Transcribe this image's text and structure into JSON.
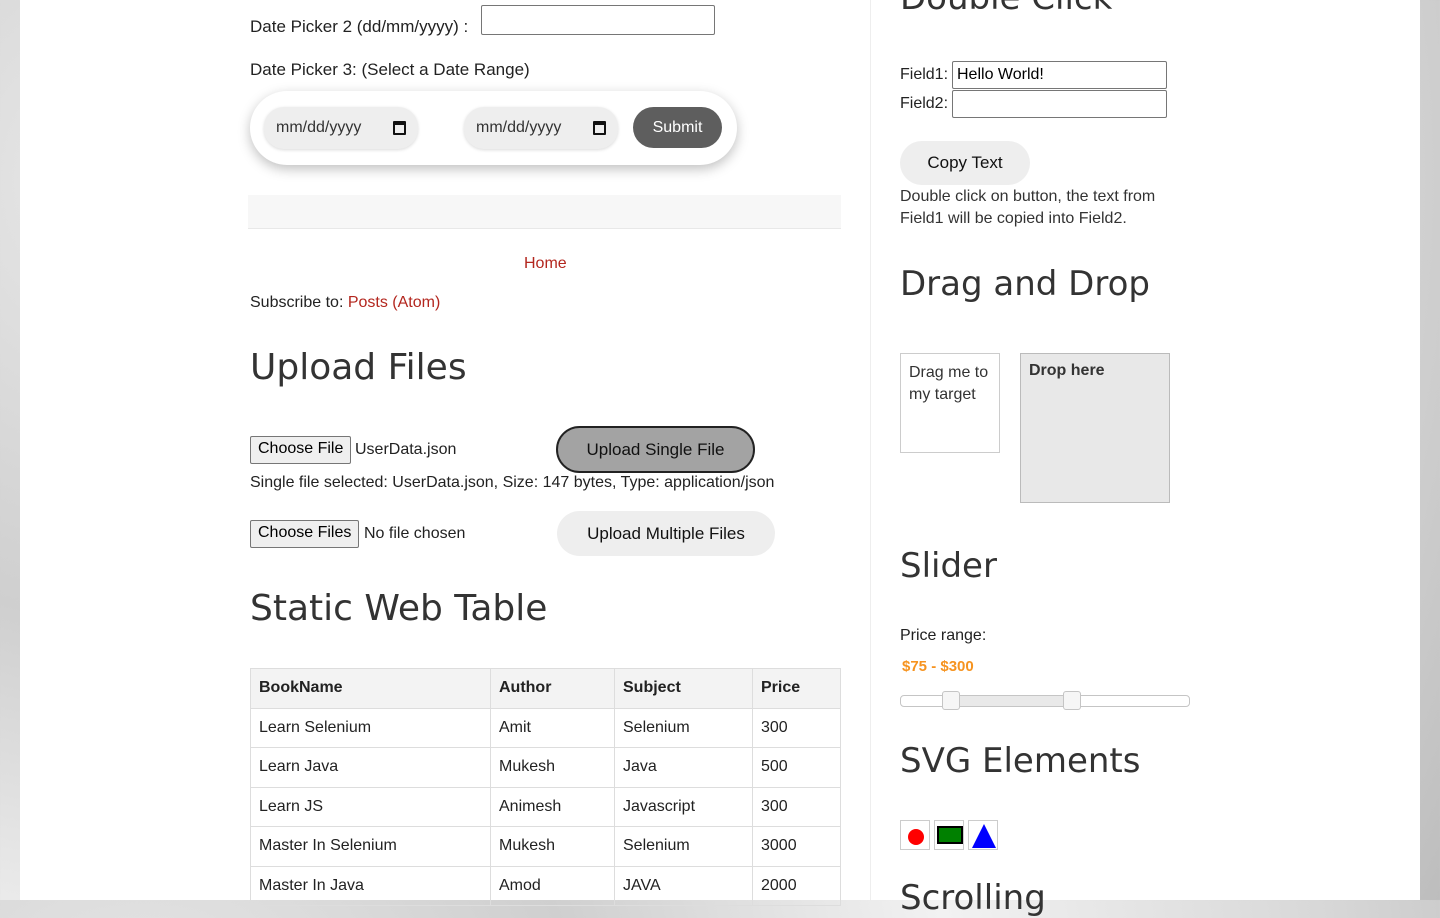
{
  "date_picker_2": {
    "label": "Date Picker 2 (dd/mm/yyyy) :",
    "value": ""
  },
  "date_picker_3": {
    "label": "Date Picker 3: (Select a Date Range)",
    "start_placeholder": "mm/dd/yyyy",
    "end_placeholder": "mm/dd/yyyy",
    "submit_label": "Submit"
  },
  "footer": {
    "home_link": "Home",
    "subscribe_prefix": "Subscribe to: ",
    "subscribe_link": "Posts (Atom)"
  },
  "upload": {
    "title": "Upload Files",
    "single_choose_label": "Choose File",
    "single_file_name": "UserData.json",
    "single_button_label": "Upload Single File",
    "single_status": "Single file selected: UserData.json, Size: 147 bytes, Type: application/json",
    "multi_choose_label": "Choose Files",
    "multi_file_name": "No file chosen",
    "multi_button_label": "Upload Multiple Files"
  },
  "static_table": {
    "title": "Static Web Table",
    "headers": [
      "BookName",
      "Author",
      "Subject",
      "Price"
    ],
    "rows": [
      [
        "Learn Selenium",
        "Amit",
        "Selenium",
        "300"
      ],
      [
        "Learn Java",
        "Mukesh",
        "Java",
        "500"
      ],
      [
        "Learn JS",
        "Animesh",
        "Javascript",
        "300"
      ],
      [
        "Master In Selenium",
        "Mukesh",
        "Selenium",
        "3000"
      ],
      [
        "Master In Java",
        "Amod",
        "JAVA",
        "2000"
      ]
    ]
  },
  "double_click": {
    "title": "Double Click",
    "field1_label": "Field1:",
    "field1_value": "Hello World!",
    "field2_label": "Field2:",
    "field2_value": "",
    "button_label": "Copy Text",
    "description": "Double click on button, the text from Field1 will be copied into Field2."
  },
  "drag_drop": {
    "title": "Drag and Drop",
    "draggable_text": "Drag me to my target",
    "droppable_text": "Drop here"
  },
  "slider": {
    "title": "Slider",
    "label": "Price range:",
    "range_text": "$75 - $300",
    "min": 0,
    "max": 500,
    "low": 75,
    "high": 300,
    "range_color": "#f6931f"
  },
  "svg_elements": {
    "title": "SVG Elements",
    "shapes": [
      {
        "name": "circle",
        "color": "#ff0000"
      },
      {
        "name": "rectangle",
        "color": "#008000"
      },
      {
        "name": "triangle",
        "color": "#0000ff"
      }
    ]
  },
  "scrolling": {
    "title": "Scrolling"
  }
}
